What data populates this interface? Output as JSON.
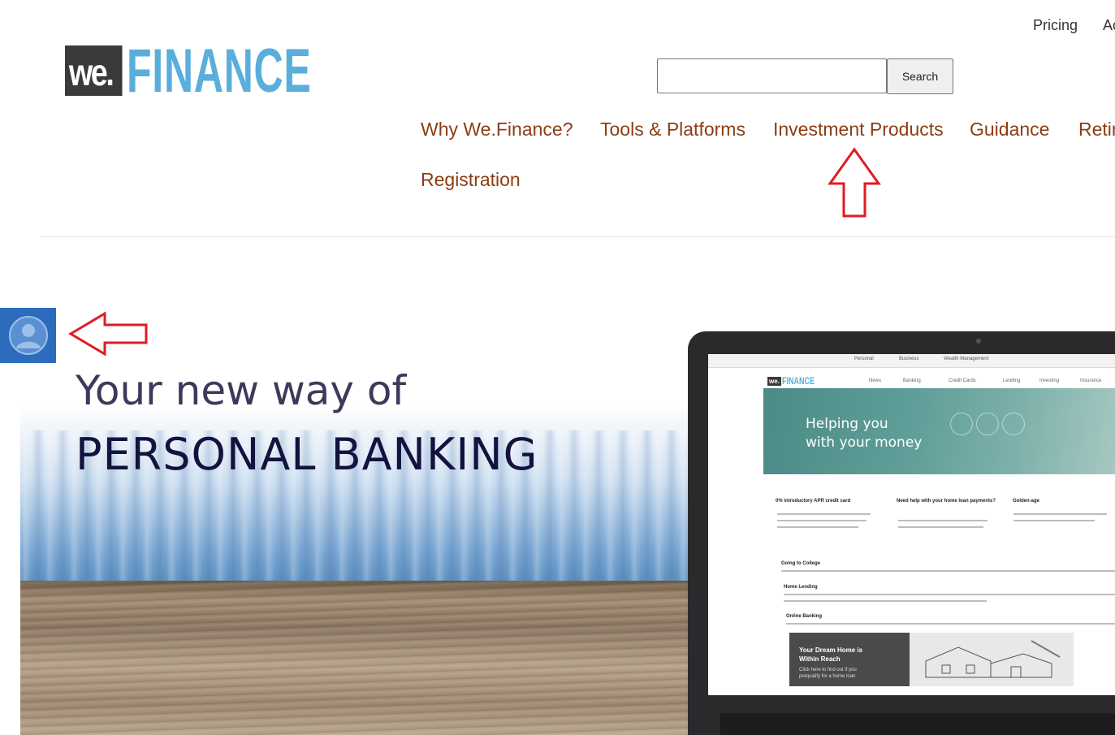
{
  "header": {
    "utility_links": [
      "Pricing",
      "Ac"
    ],
    "logo": {
      "we": "we.",
      "finance": "FINANCE"
    },
    "search": {
      "placeholder": "",
      "button_label": "Search"
    }
  },
  "nav": {
    "items": [
      "Why We.Finance?",
      "Tools & Platforms",
      "Investment Products",
      "Guidance",
      "Retir",
      "Registration"
    ]
  },
  "hero": {
    "line1": "Your new way of",
    "line2": "PERSONAL BANKING",
    "laptop_screen": {
      "tabs": [
        "Personal",
        "Business",
        "Wealth Management"
      ],
      "logo_we": "we.",
      "logo_finance": "FINANCE",
      "menu": [
        "News",
        "Banking",
        "Credit Cards",
        "Lending",
        "Investing",
        "Insurance"
      ],
      "banner_line1": "Helping you",
      "banner_line2": "with your money",
      "columns": [
        "0% introductory APR credit card",
        "Need help with your home loan payments?",
        "Golden-age"
      ],
      "rows": [
        "Going to College",
        "Home Lending",
        "Online Banking"
      ],
      "promo_title_1": "Your Dream Home is",
      "promo_title_2": "Within Reach",
      "promo_sub_1": "Click here to find out if you",
      "promo_sub_2": "prequalify for a home loan"
    }
  },
  "colors": {
    "nav_text": "#8c3d14",
    "logo_blue": "#5aaedc",
    "account_tab": "#2d6bbd",
    "annotation_red": "#e01b22",
    "hero_heading": "#13133f"
  },
  "icons": {
    "account": "user-avatar-icon",
    "annotation_up": "red-up-arrow",
    "annotation_left": "red-left-arrow"
  }
}
